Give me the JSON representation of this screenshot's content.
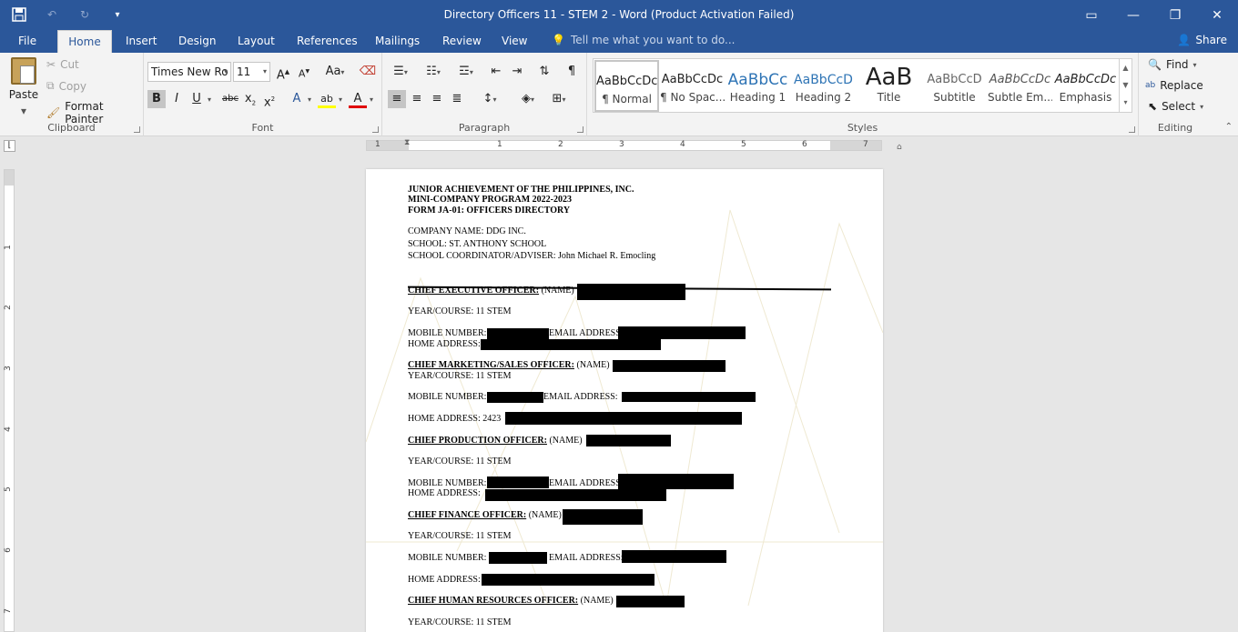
{
  "window": {
    "title": "Directory Officers 11 - STEM 2 - Word (Product Activation Failed)"
  },
  "tabs": [
    "File",
    "Home",
    "Insert",
    "Design",
    "Layout",
    "References",
    "Mailings",
    "Review",
    "View"
  ],
  "tell_me": "Tell me what you want to do...",
  "share": "Share",
  "clipboard": {
    "paste": "Paste",
    "cut": "Cut",
    "copy": "Copy",
    "format_painter": "Format Painter",
    "label": "Clipboard"
  },
  "font": {
    "name": "Times New Ro",
    "size": "11",
    "label": "Font"
  },
  "paragraph": {
    "label": "Paragraph"
  },
  "styles": {
    "label": "Styles",
    "items": [
      {
        "sample": "AaBbCcDc",
        "name": "¶ Normal"
      },
      {
        "sample": "AaBbCcDc",
        "name": "¶ No Spac..."
      },
      {
        "sample": "AaBbCc",
        "name": "Heading 1"
      },
      {
        "sample": "AaBbCcD",
        "name": "Heading 2"
      },
      {
        "sample": "AaB",
        "name": "Title"
      },
      {
        "sample": "AaBbCcD",
        "name": "Subtitle"
      },
      {
        "sample": "AaBbCcDc",
        "name": "Subtle Em..."
      },
      {
        "sample": "AaBbCcDc",
        "name": "Emphasis"
      }
    ]
  },
  "editing": {
    "find": "Find",
    "replace": "Replace",
    "select": "Select",
    "label": "Editing"
  },
  "ruler": {
    "h": [
      "1",
      "1",
      "2",
      "3",
      "4",
      "5",
      "6",
      "7"
    ],
    "v": [
      "1",
      "2",
      "3",
      "4",
      "5",
      "6",
      "7"
    ]
  },
  "document": {
    "header1": "JUNIOR ACHIEVEMENT OF THE PHILIPPINES, INC.",
    "header2": "MINI-COMPANY PROGRAM 2022-2023",
    "header3": "FORM JA-01: OFFICERS DIRECTORY",
    "company": "COMPANY NAME: DDG INC.",
    "school": "SCHOOL: ST. ANTHONY SCHOOL",
    "coordinator": "SCHOOL COORDINATOR/ADVISER: John Michael R. Emocling",
    "ceo_label": "CHIEF EXECUTIVE OFFICER:",
    "ceo_name": " (NAME)",
    "ceo_year": "YEAR/COURSE: 11 STEM",
    "ceo_mobile": "MOBILE NUMBER:",
    "ceo_email": "EMAIL ADDRESS:",
    "ceo_home": "HOME ADDRESS:",
    "cmo_label": "CHIEF MARKETING/SALES OFFICER:",
    "cmo_name": " (NAME)",
    "cmo_year": "YEAR/COURSE: 11 STEM",
    "cmo_mobile": "MOBILE NUMBER:",
    "cmo_email": "EMAIL ADDRESS:",
    "cmo_home": "HOME ADDRESS: 2423",
    "cpo_label": "CHIEF PRODUCTION OFFICER:",
    "cpo_name": " (NAME)",
    "cpo_year": "YEAR/COURSE: 11 STEM",
    "cpo_mobile": "MOBILE NUMBER:",
    "cpo_email": "EMAIL ADDRESS:",
    "cpo_home": "HOME ADDRESS:",
    "cfo_label": "CHIEF FINANCE OFFICER:",
    "cfo_name": " (NAME)",
    "cfo_year": "YEAR/COURSE: 11 STEM",
    "cfo_mobile": "MOBILE NUMBER:",
    "cfo_email": "EMAIL ADDRESS:",
    "cfo_home": "HOME ADDRESS:",
    "chro_label": "CHIEF HUMAN RESOURCES OFFICER:",
    "chro_name": " (NAME)",
    "chro_year": "YEAR/COURSE: 11 STEM"
  },
  "colors": {
    "accent": "#2b579a",
    "ribbon": "#f3f3f3",
    "canvas": "#e6e6e6"
  }
}
